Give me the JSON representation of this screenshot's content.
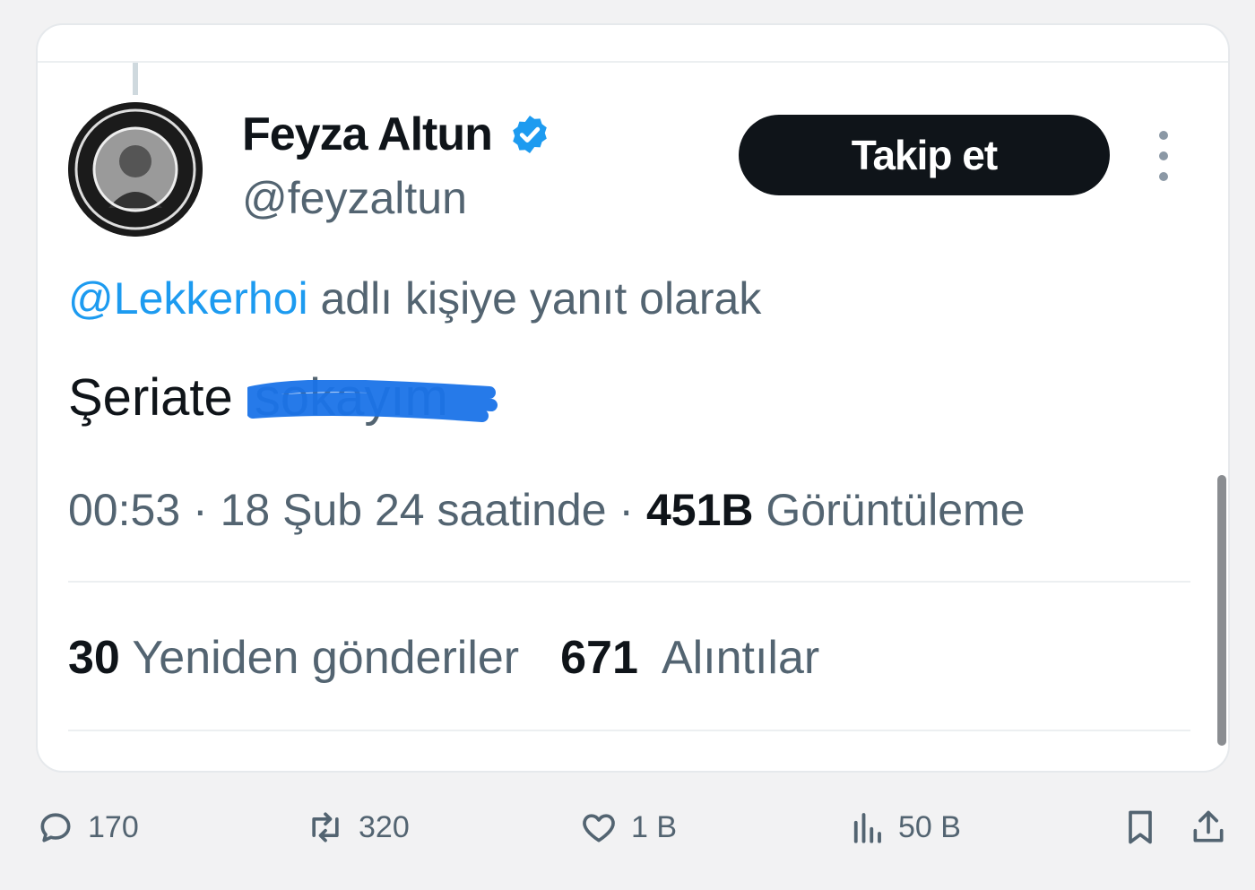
{
  "tweet": {
    "author_name": "Feyza Altun",
    "author_handle": "@feyzaltun",
    "follow_label": "Takip et",
    "reply_to_mention": "@Lekkerhoi",
    "reply_to_suffix": " adlı kişiye yanıt olarak",
    "text_visible": "Şeriate",
    "text_redacted": "sokayım",
    "time": "00:53",
    "date_text": "18 Şub 24 saatinde",
    "separator": "·",
    "views_count": "451B",
    "views_label": "Görüntüleme",
    "reposts_count": "30",
    "reposts_label": "Yeniden gönderiler",
    "quotes_count": "671",
    "quotes_label": "Alıntılar"
  },
  "actions": {
    "replies": "170",
    "reposts": "320",
    "likes": "1 B",
    "views": "50 B"
  },
  "colors": {
    "accent": "#1d9bf0",
    "text": "#0f1419",
    "muted": "#536471",
    "redaction": "#1a73e8"
  },
  "icons": [
    "verified-badge-icon",
    "more-options-icon",
    "reply-icon",
    "repost-icon",
    "like-icon",
    "views-icon",
    "bookmark-icon",
    "share-icon"
  ]
}
